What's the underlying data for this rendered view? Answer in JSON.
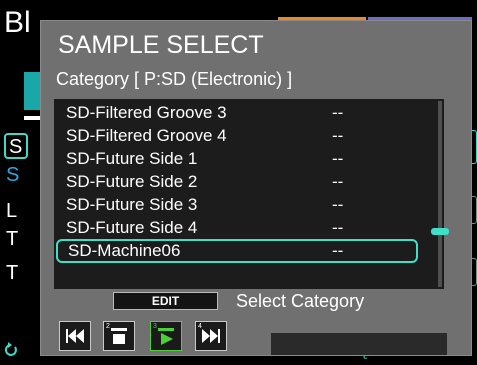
{
  "background": {
    "title": "Bl",
    "letters": {
      "s1": "S",
      "s2": "S",
      "l": "L",
      "t1": "T",
      "t2": "T"
    },
    "status_right": "t"
  },
  "dialog": {
    "title": "SAMPLE SELECT",
    "category": "Category [ P:SD (Electronic) ]",
    "items": [
      {
        "name": "SD-Filtered Groove 3",
        "value": "--",
        "selected": false
      },
      {
        "name": "SD-Filtered Groove 4",
        "value": "--",
        "selected": false
      },
      {
        "name": "SD-Future Side 1",
        "value": "--",
        "selected": false
      },
      {
        "name": "SD-Future Side 2",
        "value": "--",
        "selected": false
      },
      {
        "name": "SD-Future Side 3",
        "value": "--",
        "selected": false
      },
      {
        "name": "SD-Future Side 4",
        "value": "--",
        "selected": false
      },
      {
        "name": "SD-Machine06",
        "value": "--",
        "selected": true
      }
    ],
    "edit_label": "EDIT",
    "select_category_label": "Select Category",
    "transport": [
      {
        "icon": "skip-to-first-icon",
        "num": ""
      },
      {
        "icon": "stop-icon",
        "num": "2"
      },
      {
        "icon": "play-icon",
        "num": "3"
      },
      {
        "icon": "skip-to-last-icon",
        "num": "4"
      }
    ]
  },
  "colors": {
    "accent": "#3fe0c8",
    "play": "#4dcf3a",
    "orange_tab": "#e88a2a",
    "purple_tab": "#6a6cc8"
  }
}
